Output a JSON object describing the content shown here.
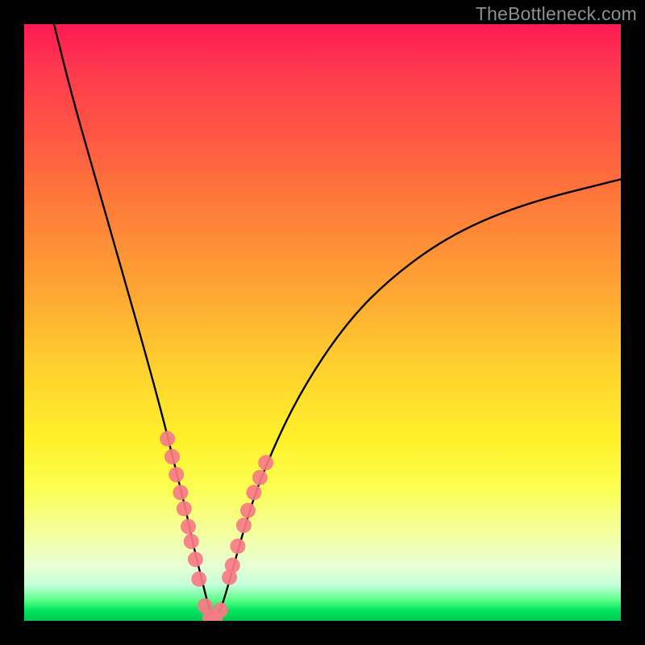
{
  "watermark": "TheBottleneck.com",
  "chart_data": {
    "type": "line",
    "title": "",
    "xlabel": "",
    "ylabel": "",
    "xlim": [
      0,
      100
    ],
    "ylim": [
      0,
      100
    ],
    "series": [
      {
        "name": "bottleneck-curve",
        "x": [
          5,
          8,
          12,
          16,
          20,
          23,
          25,
          27,
          28.5,
          30,
          31,
          32,
          33,
          34.5,
          37,
          40,
          46,
          54,
          62,
          72,
          84,
          100
        ],
        "y": [
          100,
          88,
          74,
          60,
          46,
          35,
          27,
          19,
          12,
          6,
          2,
          0.3,
          2,
          7,
          16,
          25,
          38,
          50,
          58,
          65,
          70,
          74
        ]
      }
    ],
    "markers": {
      "name": "sample-points",
      "color": "#f77b85",
      "x": [
        24.0,
        24.8,
        25.5,
        26.2,
        26.8,
        27.5,
        28.0,
        28.7,
        29.3,
        30.3,
        31.1,
        32.0,
        32.9,
        34.4,
        34.9,
        35.8,
        36.8,
        37.5,
        38.5,
        39.5,
        40.5
      ],
      "y": [
        30.5,
        27.5,
        24.5,
        21.5,
        18.8,
        15.8,
        13.3,
        10.3,
        7.0,
        2.5,
        0.6,
        0.3,
        1.8,
        7.3,
        9.3,
        12.5,
        16.0,
        18.5,
        21.5,
        24.0,
        26.5
      ]
    }
  }
}
